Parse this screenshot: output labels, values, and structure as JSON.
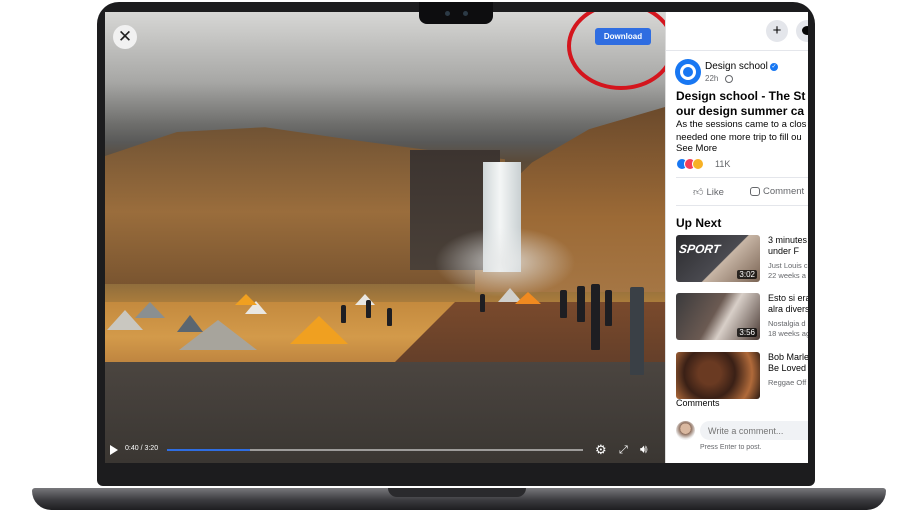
{
  "video": {
    "download_label": "Download",
    "close_icon": "close-icon",
    "current_time": "0:40",
    "duration": "3:20",
    "time_display": "0:40 / 3:20",
    "progress_fraction": 0.2,
    "accent_color": "#2f6de1",
    "highlight_color": "#d4151d"
  },
  "post": {
    "page_name": "Design school",
    "time": "22h",
    "title_lines": [
      "Design school - The St",
      "our design summer ca"
    ],
    "body_lines": [
      "As the sessions came to a clos",
      "needed one more trip to fill ou"
    ],
    "see_more": "See More",
    "reaction_count": "11K",
    "like_label": "Like",
    "comment_label": "Comment"
  },
  "up_next": {
    "heading": "Up Next",
    "items": [
      {
        "title_lines": [
          "3 minutes",
          "under F"
        ],
        "channel": "Just Louis c",
        "age": "22 weeks a",
        "duration": "3:02",
        "thumb_text": "SPORT"
      },
      {
        "title_lines": [
          "Esto si era",
          "alra divers"
        ],
        "channel": "Nostalgia d",
        "age": "18 weeks ag",
        "duration": "3:56"
      },
      {
        "title_lines": [
          "Bob Marle",
          "Be Loved"
        ],
        "channel": "Reggae Off",
        "age": "",
        "duration": ""
      }
    ]
  },
  "comments": {
    "label": "Comments",
    "placeholder": "Write a comment...",
    "hint": "Press Enter to post."
  }
}
